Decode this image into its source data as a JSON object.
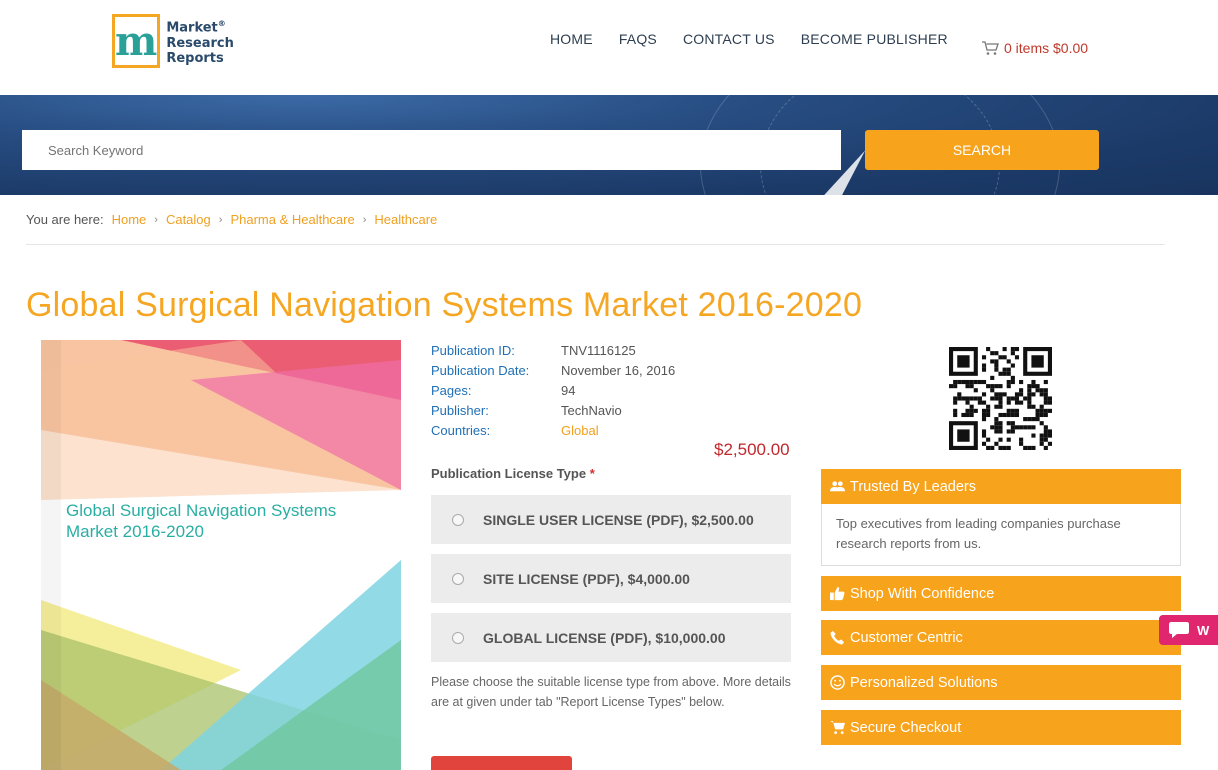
{
  "logo": {
    "line1": "Market",
    "line2": "Research",
    "line3": "Reports",
    "reg": "®",
    "mark": "m"
  },
  "nav": [
    "HOME",
    "FAQS",
    "CONTACT US",
    "BECOME PUBLISHER"
  ],
  "cart": {
    "label": "0 items $0.00"
  },
  "search": {
    "placeholder": "Search Keyword",
    "button": "SEARCH"
  },
  "breadcrumb": {
    "prefix": "You are here:",
    "items": [
      "Home",
      "Catalog",
      "Pharma & Healthcare",
      "Healthcare"
    ]
  },
  "title": "Global Surgical Navigation Systems Market 2016-2020",
  "cover": {
    "title": "Global Surgical Navigation Systems Market 2016-2020"
  },
  "details": [
    {
      "label": "Publication ID:",
      "value": "TNV1116125"
    },
    {
      "label": "Publication Date:",
      "value": "November 16, 2016"
    },
    {
      "label": "Pages:",
      "value": "94"
    },
    {
      "label": "Publisher:",
      "value": "TechNavio"
    },
    {
      "label": "Countries:",
      "value": "Global"
    }
  ],
  "price": "$2,500.00",
  "license": {
    "heading": "Publication License Type",
    "required_mark": "*",
    "options": [
      "SINGLE USER LICENSE (PDF), $2,500.00",
      "SITE LICENSE (PDF), $4,000.00",
      "GLOBAL LICENSE (PDF), $10,000.00"
    ],
    "note": "Please choose the suitable license type from above. More details are at given under tab \"Report License Types\" below."
  },
  "panels": [
    {
      "title": "Trusted By Leaders",
      "icon": "users-icon",
      "body": "Top executives from leading companies purchase research reports from us."
    },
    {
      "title": "Shop With Confidence",
      "icon": "thumbs-up-icon"
    },
    {
      "title": "Customer Centric",
      "icon": "phone-icon"
    },
    {
      "title": "Personalized Solutions",
      "icon": "smile-icon"
    },
    {
      "title": "Secure Checkout",
      "icon": "cart-icon"
    }
  ],
  "chat": {
    "label": "W"
  },
  "colors": {
    "accent": "#f8a31c",
    "title": "#f5a623",
    "link": "#1f6fb5",
    "price": "#c0282d",
    "banner": "#274d82"
  }
}
